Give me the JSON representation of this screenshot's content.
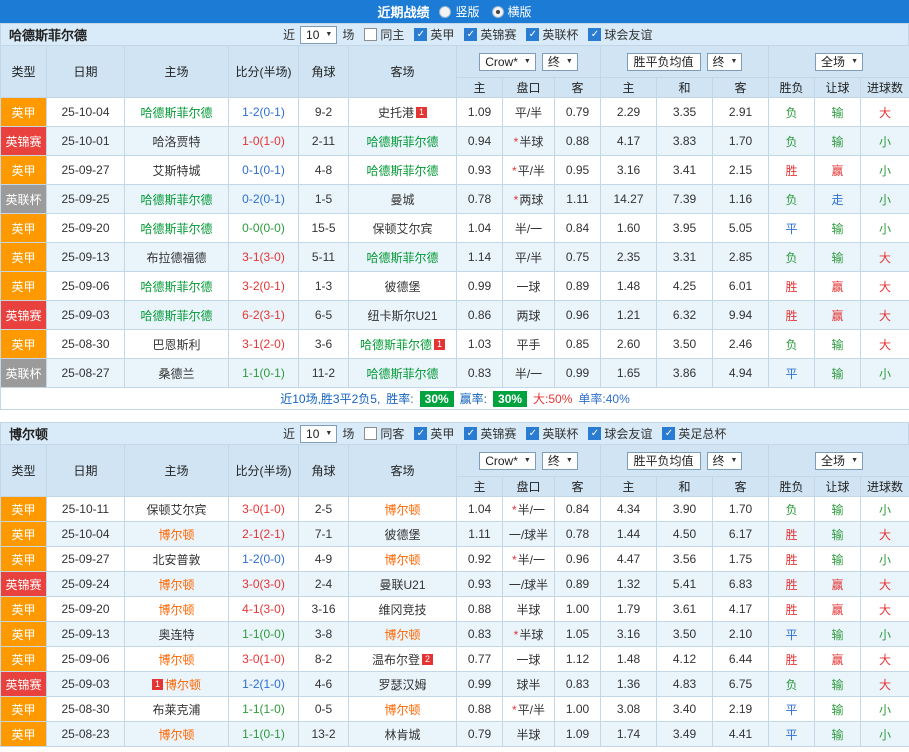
{
  "topbar": {
    "title": "近期战绩",
    "radios": [
      {
        "label": "竖版",
        "selected": false
      },
      {
        "label": "横版",
        "selected": true
      }
    ]
  },
  "table_header": {
    "cols": [
      "类型",
      "日期",
      "主场",
      "比分(半场)",
      "角球",
      "客场"
    ],
    "odds_company": "Crow*",
    "odds_time": "终",
    "avg_label": "胜平负均值",
    "avg_time": "终",
    "scope": "全场",
    "sub_cols": [
      "主",
      "盘口",
      "客",
      "主",
      "和",
      "客",
      "胜负",
      "让球",
      "进球数"
    ]
  },
  "colors": {
    "comp": {
      "英甲": "#ff9900",
      "英锦赛": "#e8413e",
      "英联杯": "#9b9b9b"
    },
    "result": {
      "red": "#e53535",
      "green": "#2e9b3d",
      "blue": "#2f6fd0"
    },
    "topbar_bg": "#1c7cd5",
    "header_bg": "#d0e4f3",
    "alt_row_bg": "#eaf4fb",
    "badge_green_bg": "#00a33e",
    "red_card_bg": "#e53333"
  },
  "sections": [
    {
      "team": "哈德斯菲尔德",
      "focus_color": "#009933",
      "near_label": "近",
      "match_count": "10",
      "unit_label": "场",
      "filters": [
        {
          "label": "同主",
          "checked": false
        },
        {
          "label": "英甲",
          "checked": true
        },
        {
          "label": "英锦赛",
          "checked": true
        },
        {
          "label": "英联杯",
          "checked": true
        },
        {
          "label": "球会友谊",
          "checked": true
        }
      ],
      "rows": [
        {
          "comp": "英甲",
          "date": "25-10-04",
          "home": {
            "name": "哈德斯菲尔德",
            "focus": true
          },
          "score": "1-2(0-1)",
          "score_color": "blue",
          "corner": "9-2",
          "away": {
            "name": "史托港",
            "card": "1",
            "card_pos": "right"
          },
          "odds": [
            "1.09",
            "平/半",
            "0.79"
          ],
          "avg": [
            "2.29",
            "3.35",
            "2.91"
          ],
          "results": [
            [
              "负",
              "green"
            ],
            [
              "输",
              "green"
            ],
            [
              "大",
              "red"
            ]
          ]
        },
        {
          "comp": "英锦赛",
          "date": "25-10-01",
          "home": {
            "name": "哈洛贾特"
          },
          "score": "1-0(1-0)",
          "score_color": "red",
          "corner": "2-11",
          "away": {
            "name": "哈德斯菲尔德",
            "focus": true
          },
          "odds": [
            "0.94",
            "*半球",
            "0.88"
          ],
          "avg": [
            "4.17",
            "3.83",
            "1.70"
          ],
          "results": [
            [
              "负",
              "green"
            ],
            [
              "输",
              "green"
            ],
            [
              "小",
              "green"
            ]
          ]
        },
        {
          "comp": "英甲",
          "date": "25-09-27",
          "home": {
            "name": "艾斯特城"
          },
          "score": "0-1(0-1)",
          "score_color": "blue",
          "corner": "4-8",
          "away": {
            "name": "哈德斯菲尔德",
            "focus": true
          },
          "odds": [
            "0.93",
            "*平/半",
            "0.95"
          ],
          "avg": [
            "3.16",
            "3.41",
            "2.15"
          ],
          "results": [
            [
              "胜",
              "red"
            ],
            [
              "赢",
              "red"
            ],
            [
              "小",
              "green"
            ]
          ]
        },
        {
          "comp": "英联杯",
          "date": "25-09-25",
          "home": {
            "name": "哈德斯菲尔德",
            "focus": true
          },
          "score": "0-2(0-1)",
          "score_color": "blue",
          "corner": "1-5",
          "away": {
            "name": "曼城"
          },
          "odds": [
            "0.78",
            "*两球",
            "1.11"
          ],
          "avg": [
            "14.27",
            "7.39",
            "1.16"
          ],
          "results": [
            [
              "负",
              "green"
            ],
            [
              "走",
              "blue"
            ],
            [
              "小",
              "green"
            ]
          ]
        },
        {
          "comp": "英甲",
          "date": "25-09-20",
          "home": {
            "name": "哈德斯菲尔德",
            "focus": true
          },
          "score": "0-0(0-0)",
          "score_color": "green",
          "corner": "15-5",
          "away": {
            "name": "保顿艾尔宾"
          },
          "odds": [
            "1.04",
            "半/一",
            "0.84"
          ],
          "avg": [
            "1.60",
            "3.95",
            "5.05"
          ],
          "results": [
            [
              "平",
              "blue"
            ],
            [
              "输",
              "green"
            ],
            [
              "小",
              "green"
            ]
          ]
        },
        {
          "comp": "英甲",
          "date": "25-09-13",
          "home": {
            "name": "布拉德福德"
          },
          "score": "3-1(3-0)",
          "score_color": "red",
          "corner": "5-11",
          "away": {
            "name": "哈德斯菲尔德",
            "focus": true
          },
          "odds": [
            "1.14",
            "平/半",
            "0.75"
          ],
          "avg": [
            "2.35",
            "3.31",
            "2.85"
          ],
          "results": [
            [
              "负",
              "green"
            ],
            [
              "输",
              "green"
            ],
            [
              "大",
              "red"
            ]
          ]
        },
        {
          "comp": "英甲",
          "date": "25-09-06",
          "home": {
            "name": "哈德斯菲尔德",
            "focus": true
          },
          "score": "3-2(0-1)",
          "score_color": "red",
          "corner": "1-3",
          "away": {
            "name": "彼德堡"
          },
          "odds": [
            "0.99",
            "一球",
            "0.89"
          ],
          "avg": [
            "1.48",
            "4.25",
            "6.01"
          ],
          "results": [
            [
              "胜",
              "red"
            ],
            [
              "赢",
              "red"
            ],
            [
              "大",
              "red"
            ]
          ]
        },
        {
          "comp": "英锦赛",
          "date": "25-09-03",
          "home": {
            "name": "哈德斯菲尔德",
            "focus": true
          },
          "score": "6-2(3-1)",
          "score_color": "red",
          "corner": "6-5",
          "away": {
            "name": "纽卡斯尔U21"
          },
          "odds": [
            "0.86",
            "两球",
            "0.96"
          ],
          "avg": [
            "1.21",
            "6.32",
            "9.94"
          ],
          "results": [
            [
              "胜",
              "red"
            ],
            [
              "赢",
              "red"
            ],
            [
              "大",
              "red"
            ]
          ]
        },
        {
          "comp": "英甲",
          "date": "25-08-30",
          "home": {
            "name": "巴恩斯利"
          },
          "score": "3-1(2-0)",
          "score_color": "red",
          "corner": "3-6",
          "away": {
            "name": "哈德斯菲尔德",
            "focus": true,
            "card": "1",
            "card_pos": "right"
          },
          "odds": [
            "1.03",
            "平手",
            "0.85"
          ],
          "avg": [
            "2.60",
            "3.50",
            "2.46"
          ],
          "results": [
            [
              "负",
              "green"
            ],
            [
              "输",
              "green"
            ],
            [
              "大",
              "red"
            ]
          ]
        },
        {
          "comp": "英联杯",
          "date": "25-08-27",
          "home": {
            "name": "桑德兰"
          },
          "score": "1-1(0-1)",
          "score_color": "green",
          "corner": "11-2",
          "away": {
            "name": "哈德斯菲尔德",
            "focus": true
          },
          "odds": [
            "0.83",
            "半/一",
            "0.99"
          ],
          "avg": [
            "1.65",
            "3.86",
            "4.94"
          ],
          "results": [
            [
              "平",
              "blue"
            ],
            [
              "输",
              "green"
            ],
            [
              "小",
              "green"
            ]
          ]
        }
      ],
      "summary": {
        "text": "近10场,胜3平2负5,",
        "win_rate_label": "胜率:",
        "win_rate": "30%",
        "handicap_rate_label": "赢率:",
        "handicap_rate": "30%",
        "big_rate": "大:50%",
        "single_rate": "单率:40%"
      }
    },
    {
      "team": "博尔顿",
      "focus_color": "#ff6600",
      "near_label": "近",
      "match_count": "10",
      "unit_label": "场",
      "filters": [
        {
          "label": "同客",
          "checked": false
        },
        {
          "label": "英甲",
          "checked": true
        },
        {
          "label": "英锦赛",
          "checked": true
        },
        {
          "label": "英联杯",
          "checked": true
        },
        {
          "label": "球会友谊",
          "checked": true
        },
        {
          "label": "英足总杯",
          "checked": true
        }
      ],
      "rows": [
        {
          "comp": "英甲",
          "date": "25-10-11",
          "home": {
            "name": "保顿艾尔宾"
          },
          "score": "3-0(1-0)",
          "score_color": "red",
          "corner": "2-5",
          "away": {
            "name": "博尔顿",
            "focus": true
          },
          "odds": [
            "1.04",
            "*半/一",
            "0.84"
          ],
          "avg": [
            "4.34",
            "3.90",
            "1.70"
          ],
          "results": [
            [
              "负",
              "green"
            ],
            [
              "输",
              "green"
            ],
            [
              "小",
              "green"
            ]
          ]
        },
        {
          "comp": "英甲",
          "date": "25-10-04",
          "home": {
            "name": "博尔顿",
            "focus": true
          },
          "score": "2-1(2-1)",
          "score_color": "red",
          "corner": "7-1",
          "away": {
            "name": "彼德堡"
          },
          "odds": [
            "1.11",
            "一/球半",
            "0.78"
          ],
          "avg": [
            "1.44",
            "4.50",
            "6.17"
          ],
          "results": [
            [
              "胜",
              "red"
            ],
            [
              "输",
              "green"
            ],
            [
              "大",
              "red"
            ]
          ]
        },
        {
          "comp": "英甲",
          "date": "25-09-27",
          "home": {
            "name": "北安普敦"
          },
          "score": "1-2(0-0)",
          "score_color": "blue",
          "corner": "4-9",
          "away": {
            "name": "博尔顿",
            "focus": true
          },
          "odds": [
            "0.92",
            "*半/一",
            "0.96"
          ],
          "avg": [
            "4.47",
            "3.56",
            "1.75"
          ],
          "results": [
            [
              "胜",
              "red"
            ],
            [
              "输",
              "green"
            ],
            [
              "小",
              "green"
            ]
          ]
        },
        {
          "comp": "英锦赛",
          "date": "25-09-24",
          "home": {
            "name": "博尔顿",
            "focus": true
          },
          "score": "3-0(3-0)",
          "score_color": "red",
          "corner": "2-4",
          "away": {
            "name": "曼联U21"
          },
          "odds": [
            "0.93",
            "一/球半",
            "0.89"
          ],
          "avg": [
            "1.32",
            "5.41",
            "6.83"
          ],
          "results": [
            [
              "胜",
              "red"
            ],
            [
              "赢",
              "red"
            ],
            [
              "大",
              "red"
            ]
          ]
        },
        {
          "comp": "英甲",
          "date": "25-09-20",
          "home": {
            "name": "博尔顿",
            "focus": true
          },
          "score": "4-1(3-0)",
          "score_color": "red",
          "corner": "3-16",
          "away": {
            "name": "维冈竞技"
          },
          "odds": [
            "0.88",
            "半球",
            "1.00"
          ],
          "avg": [
            "1.79",
            "3.61",
            "4.17"
          ],
          "results": [
            [
              "胜",
              "red"
            ],
            [
              "赢",
              "red"
            ],
            [
              "大",
              "red"
            ]
          ]
        },
        {
          "comp": "英甲",
          "date": "25-09-13",
          "home": {
            "name": "奥连特"
          },
          "score": "1-1(0-0)",
          "score_color": "green",
          "corner": "3-8",
          "away": {
            "name": "博尔顿",
            "focus": true
          },
          "odds": [
            "0.83",
            "*半球",
            "1.05"
          ],
          "avg": [
            "3.16",
            "3.50",
            "2.10"
          ],
          "results": [
            [
              "平",
              "blue"
            ],
            [
              "输",
              "green"
            ],
            [
              "小",
              "green"
            ]
          ]
        },
        {
          "comp": "英甲",
          "date": "25-09-06",
          "home": {
            "name": "博尔顿",
            "focus": true
          },
          "score": "3-0(1-0)",
          "score_color": "red",
          "corner": "8-2",
          "away": {
            "name": "温布尔登",
            "card": "2",
            "card_pos": "right"
          },
          "odds": [
            "0.77",
            "一球",
            "1.12"
          ],
          "avg": [
            "1.48",
            "4.12",
            "6.44"
          ],
          "results": [
            [
              "胜",
              "red"
            ],
            [
              "赢",
              "red"
            ],
            [
              "大",
              "red"
            ]
          ]
        },
        {
          "comp": "英锦赛",
          "date": "25-09-03",
          "home": {
            "name": "博尔顿",
            "focus": true,
            "card": "1",
            "card_pos": "left"
          },
          "score": "1-2(1-0)",
          "score_color": "blue",
          "corner": "4-6",
          "away": {
            "name": "罗瑟汉姆"
          },
          "odds": [
            "0.99",
            "球半",
            "0.83"
          ],
          "avg": [
            "1.36",
            "4.83",
            "6.75"
          ],
          "results": [
            [
              "负",
              "green"
            ],
            [
              "输",
              "green"
            ],
            [
              "大",
              "red"
            ]
          ]
        },
        {
          "comp": "英甲",
          "date": "25-08-30",
          "home": {
            "name": "布莱克浦"
          },
          "score": "1-1(1-0)",
          "score_color": "green",
          "corner": "0-5",
          "away": {
            "name": "博尔顿",
            "focus": true
          },
          "odds": [
            "0.88",
            "*平/半",
            "1.00"
          ],
          "avg": [
            "3.08",
            "3.40",
            "2.19"
          ],
          "results": [
            [
              "平",
              "blue"
            ],
            [
              "输",
              "green"
            ],
            [
              "小",
              "green"
            ]
          ]
        },
        {
          "comp": "英甲",
          "date": "25-08-23",
          "home": {
            "name": "博尔顿",
            "focus": true
          },
          "score": "1-1(0-1)",
          "score_color": "green",
          "corner": "13-2",
          "away": {
            "name": "林肯城"
          },
          "odds": [
            "0.79",
            "半球",
            "1.09"
          ],
          "avg": [
            "1.74",
            "3.49",
            "4.41"
          ],
          "results": [
            [
              "平",
              "blue"
            ],
            [
              "输",
              "green"
            ],
            [
              "小",
              "green"
            ]
          ]
        }
      ],
      "summary": null
    }
  ]
}
